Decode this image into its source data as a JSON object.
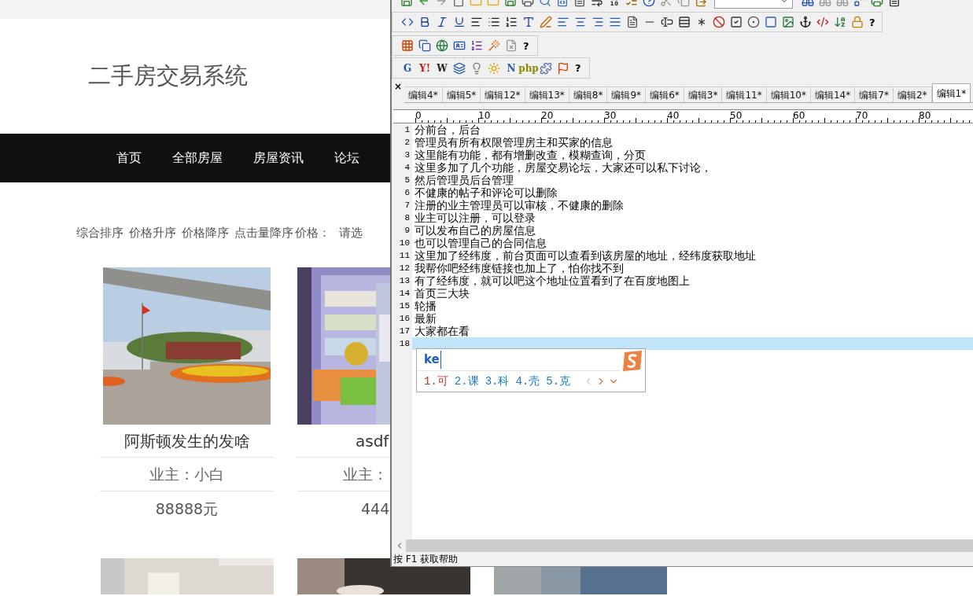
{
  "site": {
    "title": "二手房交易系统",
    "nav": [
      {
        "label": "首页"
      },
      {
        "label": "全部房屋"
      },
      {
        "label": "房屋资讯"
      },
      {
        "label": "论坛"
      }
    ],
    "sort_options": [
      {
        "label": "综合排序"
      },
      {
        "label": "价格升序"
      },
      {
        "label": "价格降序"
      },
      {
        "label": "点击量降序"
      }
    ],
    "price_label": "价格：",
    "price_select": "请选",
    "listings": [
      {
        "kind": "picture",
        "title": "阿斯顿发生的发啥",
        "owner": "业主：小白",
        "price": "88888元"
      },
      {
        "kind": "picture",
        "title": "asdf",
        "owner": "业主：",
        "price": "444"
      }
    ]
  },
  "editor": {
    "toolbars": [
      {
        "help": "?"
      },
      {
        "help": "?"
      }
    ],
    "search_toolbar": {
      "items": [
        {
          "kind": "letter",
          "text": "G"
        },
        {
          "kind": "letter",
          "text": "Y!"
        },
        {
          "kind": "letter",
          "text": "W"
        },
        {
          "kind": "icon"
        },
        {
          "kind": "icon"
        },
        {
          "kind": "icon"
        },
        {
          "kind": "letter",
          "text": "N"
        },
        {
          "kind": "letter",
          "text": "php"
        },
        {
          "kind": "icon"
        },
        {
          "kind": "icon"
        }
      ],
      "help": "?"
    },
    "close_mark": "×",
    "tabs": [
      {
        "label": "编辑4*",
        "selected": false
      },
      {
        "label": "编辑5*",
        "selected": false
      },
      {
        "label": "编辑12*",
        "selected": false
      },
      {
        "label": "编辑13*",
        "selected": false
      },
      {
        "label": "编辑8*",
        "selected": false
      },
      {
        "label": "编辑9*",
        "selected": false
      },
      {
        "label": "编辑6*",
        "selected": false
      },
      {
        "label": "编辑3*",
        "selected": false
      },
      {
        "label": "编辑11*",
        "selected": false
      },
      {
        "label": "编辑10*",
        "selected": false
      },
      {
        "label": "编辑14*",
        "selected": false
      },
      {
        "label": "编辑7*",
        "selected": false
      },
      {
        "label": "编辑2*",
        "selected": false
      },
      {
        "label": "编辑1*",
        "selected": true
      }
    ],
    "ruler": [
      "0",
      "10",
      "20",
      "30",
      "40",
      "50",
      "60",
      "70",
      "80"
    ],
    "lines": [
      {
        "number": "1",
        "text": "分前台，后台",
        "current": false
      },
      {
        "number": "2",
        "text": "管理员有所有权限管理房主和买家的信息",
        "current": false
      },
      {
        "number": "3",
        "text": "这里能有功能，都有增删改查，模糊查询，分页",
        "current": false
      },
      {
        "number": "4",
        "text": "这里多加了几个功能，房屋交易论坛，大家还可以私下讨论，",
        "current": false
      },
      {
        "number": "5",
        "text": "然后管理员后台管理",
        "current": false
      },
      {
        "number": "6",
        "text": "不健康的帖子和评论可以删除",
        "current": false
      },
      {
        "number": "7",
        "text": "注册的业主管理员可以审核，不健康的删除",
        "current": false
      },
      {
        "number": "8",
        "text": "业主可以注册，可以登录",
        "current": false
      },
      {
        "number": "9",
        "text": "可以发布自己的房屋信息",
        "current": false
      },
      {
        "number": "10",
        "text": "也可以管理自己的合同信息",
        "current": false
      },
      {
        "number": "11",
        "text": "这里加了经纬度，前台页面可以查看到该房屋的地址，经纬度获取地址",
        "current": false
      },
      {
        "number": "12",
        "text": "我帮你吧经纬度链接也加上了，怕你找不到",
        "current": false
      },
      {
        "number": "13",
        "text": "有了经纬度，就可以吧这个地址位置看到了在百度地图上",
        "current": false
      },
      {
        "number": "14",
        "text": "首页三大块",
        "current": false
      },
      {
        "number": "15",
        "text": "轮播",
        "current": false
      },
      {
        "number": "16",
        "text": "最新",
        "current": false
      },
      {
        "number": "17",
        "text": "大家都在看",
        "current": false
      },
      {
        "number": "18",
        "current": true
      }
    ],
    "ime": {
      "input": "ke",
      "candidates": [
        {
          "label": "1.可",
          "selected": true
        },
        {
          "label": "2.课",
          "selected": false
        },
        {
          "label": "3.科",
          "selected": false
        },
        {
          "label": "4.壳",
          "selected": false
        },
        {
          "label": "5.克",
          "selected": false
        }
      ]
    },
    "status": "按 F1 获取帮助"
  }
}
